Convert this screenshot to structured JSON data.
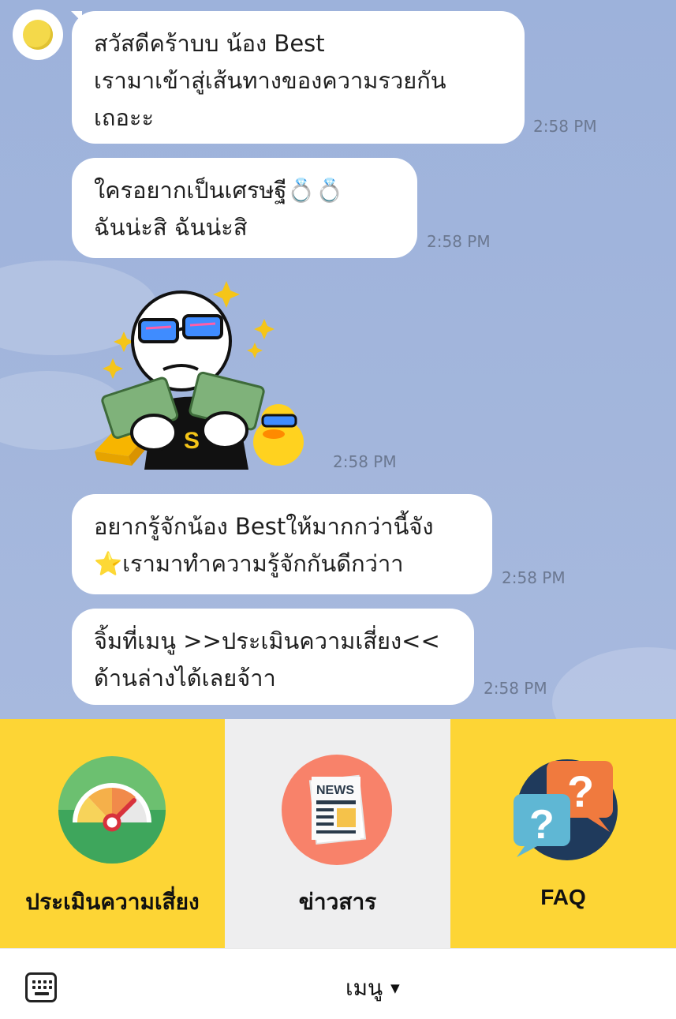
{
  "chat": {
    "messages": [
      {
        "lines": [
          "สวัสดีคร้าบบ น้อง Best",
          "เรามาเข้าสู่เส้นทางของความรวยกัน",
          "เถอะะ"
        ],
        "time": "2:58 PM"
      },
      {
        "lines": [
          "ใครอยากเป็นเศรษฐี💍💍",
          "ฉันน่ะสิ ฉันน่ะสิ"
        ],
        "time": "2:58 PM"
      },
      {
        "sticker": "rich-character-sticker",
        "time": "2:58 PM"
      },
      {
        "lines": [
          "อยากรู้จักน้อง Bestให้มากกว่านี้จัง",
          "⭐เรามาทำความรู้จักกันดีกว่าา"
        ],
        "time": "2:58 PM"
      },
      {
        "lines": [
          "จิ้มที่เมนู >>ประเมินความเสี่ยง<<",
          "ด้านล่างได้เลยจ้าา"
        ],
        "time": "2:58 PM"
      }
    ]
  },
  "rich_menu": {
    "items": [
      {
        "label": "ประเมินความเสี่ยง",
        "icon": "gauge-icon",
        "bg": "#fdd535"
      },
      {
        "label": "ข่าวสาร",
        "icon": "news-icon",
        "icon_text": "NEWS",
        "bg": "#eeeeef"
      },
      {
        "label": "FAQ",
        "icon": "question-icon",
        "bg": "#fdd535"
      }
    ]
  },
  "bottom_bar": {
    "menu_label": "เมนู",
    "keyboard_icon": "keyboard-icon",
    "caret_icon": "caret-down-icon"
  },
  "colors": {
    "chat_bg": "#9fb3d9",
    "bubble": "#ffffff",
    "menu_yellow": "#fdd535",
    "menu_gray": "#eeeeef"
  }
}
